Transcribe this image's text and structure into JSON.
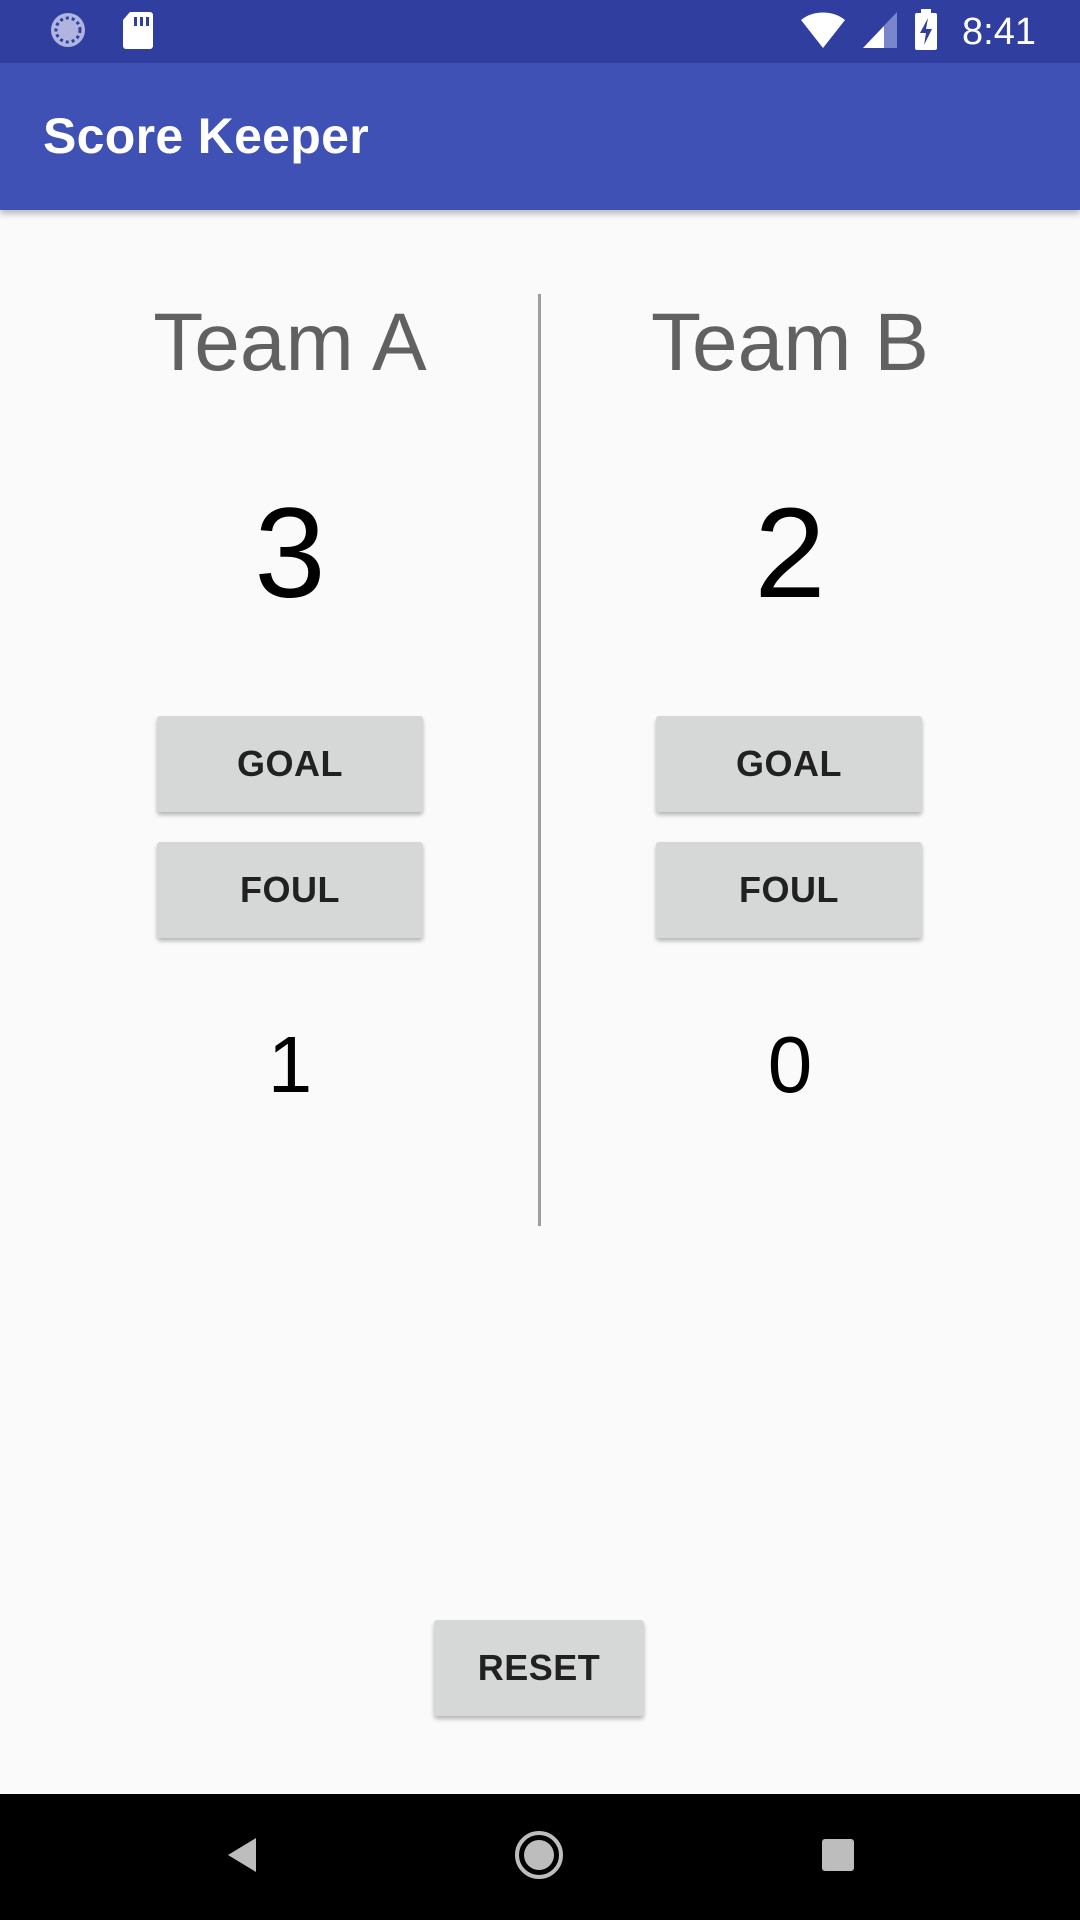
{
  "status_bar": {
    "time": "8:41",
    "left_icons": [
      "loading-icon",
      "sd-card-icon"
    ],
    "right_icons": [
      "wifi-icon",
      "cell-signal-icon",
      "battery-charging-icon"
    ]
  },
  "app_bar": {
    "title": "Score Keeper",
    "color": "#3F51B5",
    "status_color": "#303F9F"
  },
  "team_a": {
    "name": "Team A",
    "score": "3",
    "goal_label": "GOAL",
    "foul_label": "FOUL",
    "fouls": "1"
  },
  "team_b": {
    "name": "Team B",
    "score": "2",
    "goal_label": "GOAL",
    "foul_label": "FOUL",
    "fouls": "0"
  },
  "reset_label": "RESET",
  "nav_bar": {
    "buttons": [
      "back-icon",
      "home-icon",
      "recents-icon"
    ]
  }
}
